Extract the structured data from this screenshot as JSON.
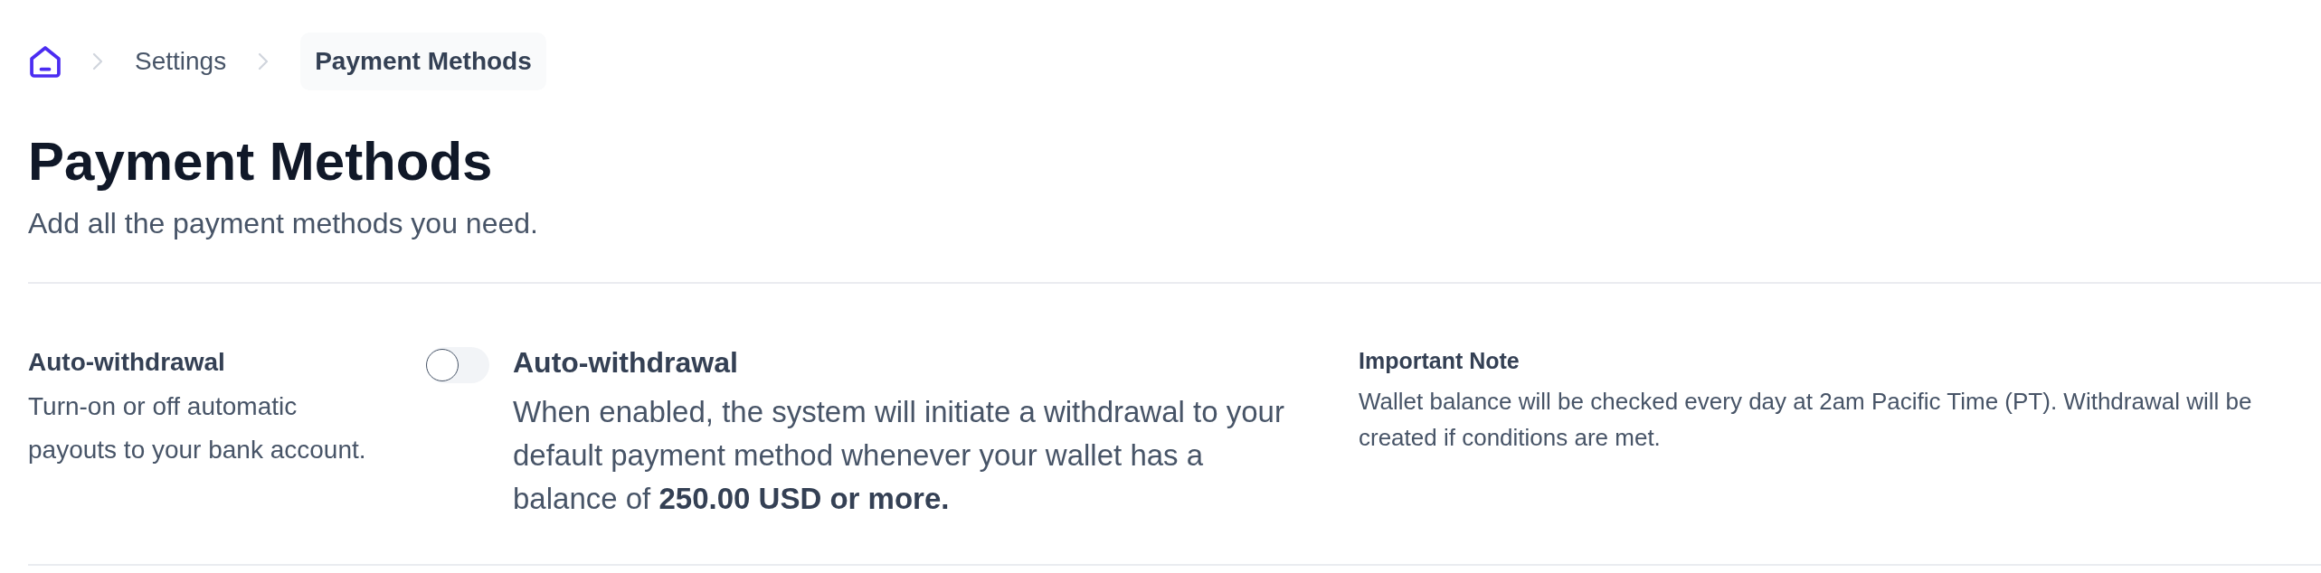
{
  "breadcrumb": {
    "items": [
      {
        "label": "Settings",
        "current": false
      },
      {
        "label": "Payment Methods",
        "current": true
      }
    ]
  },
  "page": {
    "title": "Payment Methods",
    "subtitle": "Add all the payment methods you need."
  },
  "auto_withdrawal": {
    "label": "Auto-withdrawal",
    "description": "Turn-on or off automatic payouts to your bank account.",
    "toggle": {
      "on": false
    },
    "title": "Auto-withdrawal",
    "details": "When enabled, the system will initiate a withdrawal to your default payment method whenever your wallet has a balance of **250.00 USD or more.**"
  },
  "note": {
    "title": "Important Note",
    "text": "Wallet balance will be checked every day at 2am Pacific Time (PT). Withdrawal will be created if conditions are met."
  }
}
